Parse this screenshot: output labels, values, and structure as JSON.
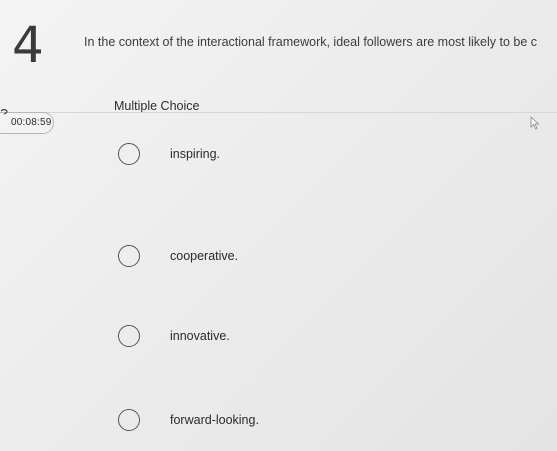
{
  "question": {
    "number": "4",
    "text": "In the context of the interactional framework, ideal followers are most likely to be c",
    "type": "Multiple Choice"
  },
  "timer": {
    "value": "00:08:59",
    "icon": "clock-icon"
  },
  "options": [
    {
      "label": "inspiring."
    },
    {
      "label": "cooperative."
    },
    {
      "label": "innovative."
    },
    {
      "label": "forward-looking."
    }
  ],
  "colors": {
    "background": "#ececec",
    "text": "#2b2b2b",
    "radio_border": "#555555"
  }
}
